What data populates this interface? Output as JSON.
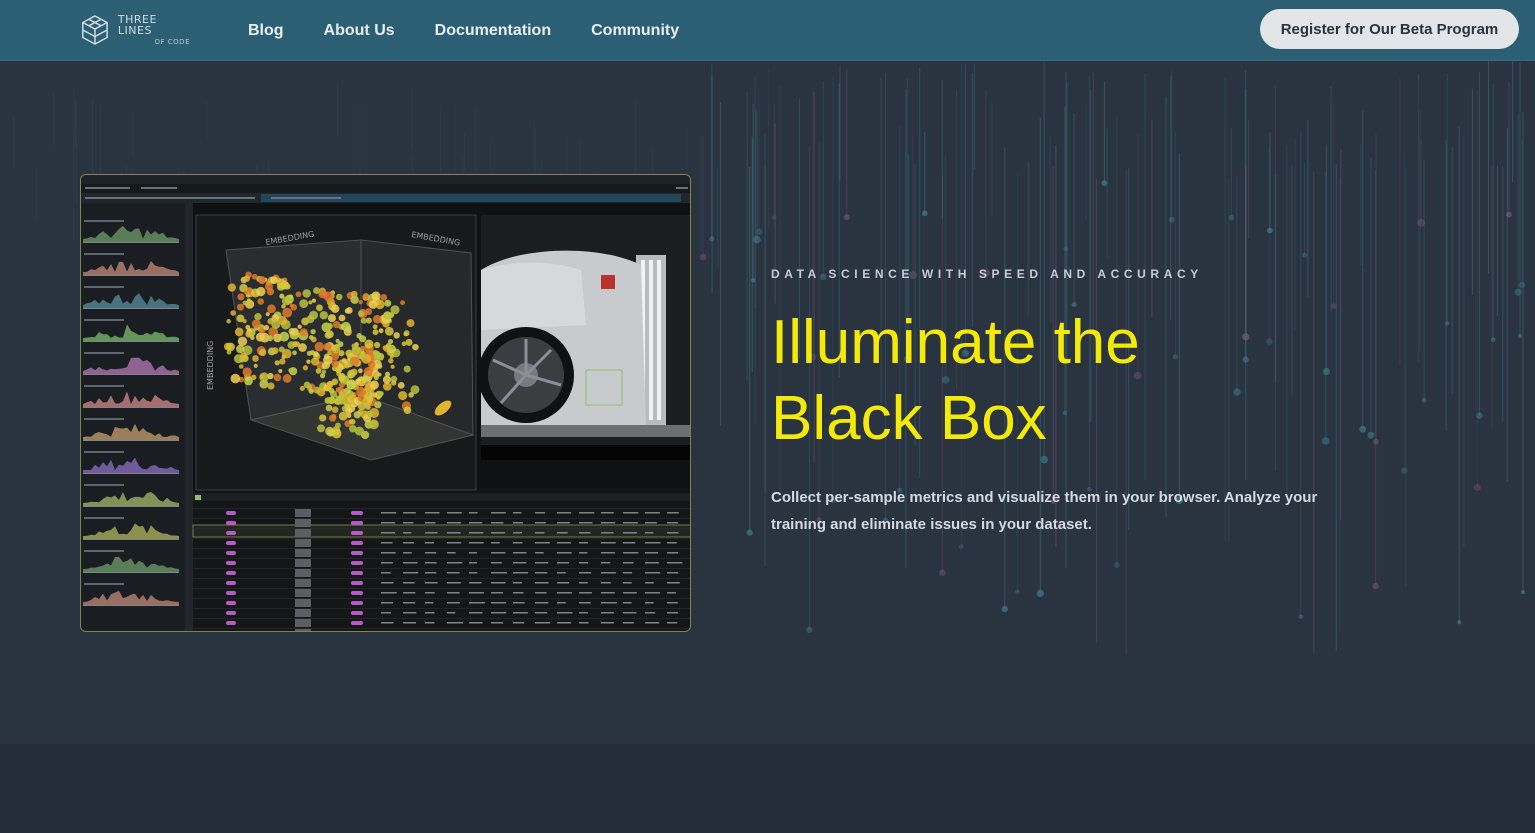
{
  "header": {
    "logo": {
      "line1": "THREE LINES",
      "line2": "OF CODE"
    },
    "nav": [
      {
        "label": "Blog"
      },
      {
        "label": "About Us"
      },
      {
        "label": "Documentation"
      },
      {
        "label": "Community"
      }
    ],
    "cta_label": "Register for Our Beta Program"
  },
  "hero": {
    "eyebrow": "DATA SCIENCE WITH SPEED AND ACCURACY",
    "headline_line1": "Illuminate the",
    "headline_line2": "Black Box",
    "description": "Collect per-sample metrics and visualize them in your browser. Analyze your training and eliminate issues in your dataset."
  },
  "screenshot_app": {
    "embedding_label": "EMBEDDING"
  },
  "colors": {
    "header_bg": "#2c5f73",
    "page_bg": "#2a3340",
    "headline": "#f3ea0a",
    "cta_bg": "#e3e5e8"
  }
}
